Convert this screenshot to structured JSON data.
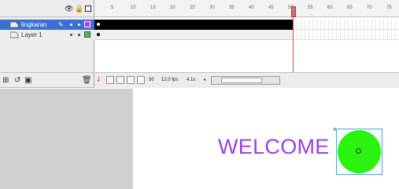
{
  "timeline": {
    "header_icons": [
      "eye-icon",
      "lock-icon",
      "outline-icon"
    ],
    "layers": [
      {
        "name": "lingkaran",
        "selected": true,
        "color": "#cc33cc",
        "icon": "layer-icon"
      },
      {
        "name": "Layer 1",
        "selected": false,
        "color": "#33cc33",
        "icon": "layer-icon"
      }
    ],
    "ruler_ticks": [
      "5",
      "10",
      "15",
      "20",
      "25",
      "30",
      "35",
      "40",
      "45",
      "50",
      "55",
      "60",
      "65",
      "70",
      "75"
    ],
    "current_frame": "50",
    "frame_rate": "12.0 fps",
    "elapsed": "4.1s"
  },
  "stage": {
    "text": "WELCOME",
    "text_color": "#9b3fe0",
    "circle_color": "#2bf20f"
  }
}
